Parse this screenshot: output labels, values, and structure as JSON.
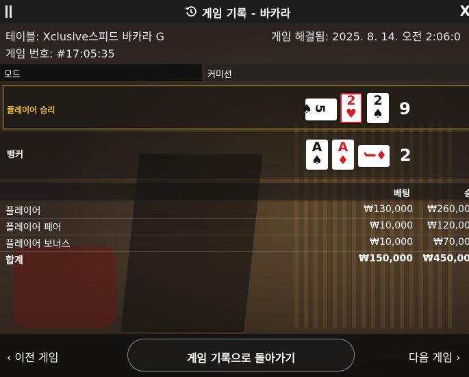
{
  "header": {
    "title": "게임 기록 - 바카라",
    "menu_icon": "pause-bars-icon",
    "history_icon": "history-clock-icon",
    "close_icon": "close-icon",
    "close_label": "X"
  },
  "info": {
    "table": "테이블: Xclusive스피드 바카라 G",
    "resolved": "게임 해결됨: 2025. 8. 14. 오전 2:06:0",
    "game_number": "게임 번호: #17:05:35"
  },
  "columns": {
    "mode": "모드",
    "commission": "커미션"
  },
  "result": {
    "player": {
      "label": "플레이어 승리",
      "cards": [
        {
          "rank": "5",
          "suit": "♠",
          "color": "#111111",
          "rotated": true
        },
        {
          "rank": "2",
          "suit": "♥",
          "color": "#d51d26",
          "rotated": false
        },
        {
          "rank": "2",
          "suit": "♠",
          "color": "#111111",
          "rotated": false
        }
      ],
      "score": "9"
    },
    "banker": {
      "label": "뱅커",
      "cards": [
        {
          "rank": "A",
          "suit": "♠",
          "color": "#111111",
          "rotated": false
        },
        {
          "rank": "A",
          "suit": "♦",
          "color": "#d51d26",
          "rotated": false
        },
        {
          "rank": "J",
          "suit": "♦",
          "color": "#d51d26",
          "rotated": true
        }
      ],
      "score": "2"
    },
    "accent_color": "#c9a227"
  },
  "bets": {
    "bet_header": "베팅",
    "win_header": "승",
    "rows": [
      {
        "name": "플레이어",
        "bet": "₩130,000",
        "win": "₩260,00"
      },
      {
        "name": "플레이어 페어",
        "bet": "₩10,000",
        "win": "₩120,00"
      },
      {
        "name": "플레이어 보너스",
        "bet": "₩10,000",
        "win": "₩70,00"
      }
    ],
    "total": {
      "name": "합계",
      "bet": "₩150,000",
      "win": "₩450,00"
    }
  },
  "footer": {
    "prev": "‹  이전 게임",
    "back": "게임 기록으로 돌아가기",
    "next": "다음 게임  ›"
  }
}
